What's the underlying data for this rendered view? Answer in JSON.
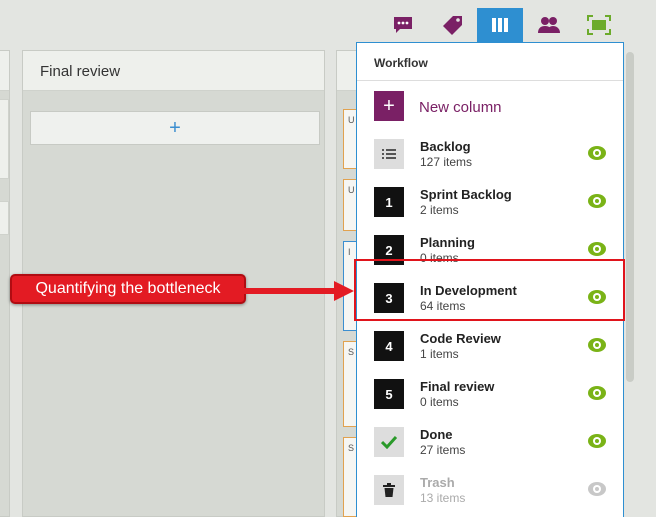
{
  "toolbar": {
    "icons": [
      "comment-icon",
      "tag-icon",
      "columns-icon",
      "users-icon",
      "fullscreen-icon"
    ],
    "active": "columns-icon",
    "colors": {
      "plum": "#7a2065",
      "active_bg": "#2e8fd1"
    }
  },
  "board": {
    "final_review_title": "Final review",
    "add_symbol": "+",
    "partial_letters": {
      "a": "U",
      "b": "U",
      "c": "I",
      "d": "S",
      "e": "S"
    }
  },
  "workflow": {
    "title": "Workflow",
    "new_column_label": "New column",
    "new_column_symbol": "+",
    "rows": [
      {
        "badge": "list-icon",
        "name": "Backlog",
        "count": "127 items"
      },
      {
        "badge": "1",
        "name": "Sprint Backlog",
        "count": "2 items"
      },
      {
        "badge": "2",
        "name": "Planning",
        "count": "0 items"
      },
      {
        "badge": "3",
        "name": "In Development",
        "count": "64 items"
      },
      {
        "badge": "4",
        "name": "Code Review",
        "count": "1 items"
      },
      {
        "badge": "5",
        "name": "Final review",
        "count": "0 items"
      },
      {
        "badge": "check-icon",
        "name": "Done",
        "count": "27 items"
      },
      {
        "badge": "trash-icon",
        "name": "Trash",
        "count": "13 items"
      }
    ],
    "eye_color": "#7ab317"
  },
  "annotation": {
    "callout_text": "Quantifying the bottleneck",
    "highlight_color": "#e0141c"
  }
}
